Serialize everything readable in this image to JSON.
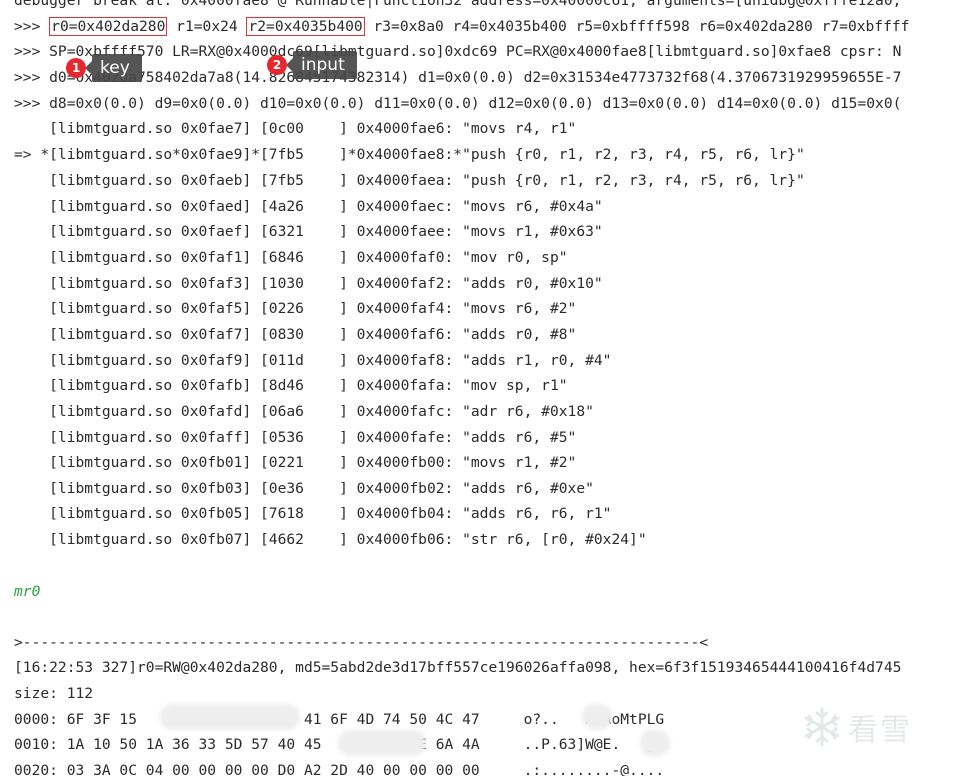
{
  "console": {
    "header_line": "debugger break at: 0x4000fae8 @ Runnable|Function32 address=0x40000c61, arguments=[unidbg@0xfffe12a0,",
    "regs_line": {
      "prompt": ">>> ",
      "r0": "r0=0x402da280",
      "mid": " r1=0x24 ",
      "r2": "r2=0x4035b400",
      "rest": " r3=0x8a0 r4=0x4035b400 r5=0xbffff598 r6=0x402da280 r7=0xbffff"
    },
    "sp_line": ">>> SP=0xbffff570 LR=RX@0x4000dc69[libmtguard.so]0xdc69 PC=RX@0x4000fae8[libmtguard.so]0xfae8 cpsr: N",
    "d0_line": ">>> d0=0x402da758402da7a8(14.826845174382314) d1=0x0(0.0) d2=0x31534e4773732f68(4.3706731929959655E-7",
    "d8_line": ">>> d8=0x0(0.0) d9=0x0(0.0) d10=0x0(0.0) d11=0x0(0.0) d12=0x0(0.0) d13=0x0(0.0) d14=0x0(0.0) d15=0x0(",
    "asm_lines": [
      "    [libmtguard.so 0x0fae7] [0c00    ] 0x4000fae6: \"movs r4, r1\"",
      "=> *[libmtguard.so*0x0fae9]*[7fb5    ]*0x4000fae8:*\"push {r0, r1, r2, r3, r4, r5, r6, lr}\"",
      "    [libmtguard.so 0x0faeb] [7fb5    ] 0x4000faea: \"push {r0, r1, r2, r3, r4, r5, r6, lr}\"",
      "    [libmtguard.so 0x0faed] [4a26    ] 0x4000faec: \"movs r6, #0x4a\"",
      "    [libmtguard.so 0x0faef] [6321    ] 0x4000faee: \"movs r1, #0x63\"",
      "    [libmtguard.so 0x0faf1] [6846    ] 0x4000faf0: \"mov r0, sp\"",
      "    [libmtguard.so 0x0faf3] [1030    ] 0x4000faf2: \"adds r0, #0x10\"",
      "    [libmtguard.so 0x0faf5] [0226    ] 0x4000faf4: \"movs r6, #2\"",
      "    [libmtguard.so 0x0faf7] [0830    ] 0x4000faf6: \"adds r0, #8\"",
      "    [libmtguard.so 0x0faf9] [011d    ] 0x4000faf8: \"adds r1, r0, #4\"",
      "    [libmtguard.so 0x0fafb] [8d46    ] 0x4000fafa: \"mov sp, r1\"",
      "    [libmtguard.so 0x0fafd] [06a6    ] 0x4000fafc: \"adr r6, #0x18\"",
      "    [libmtguard.so 0x0faff] [0536    ] 0x4000fafe: \"adds r6, #5\"",
      "    [libmtguard.so 0x0fb01] [0221    ] 0x4000fb00: \"movs r1, #2\"",
      "    [libmtguard.so 0x0fb03] [0e36    ] 0x4000fb02: \"adds r6, #0xe\"",
      "    [libmtguard.so 0x0fb05] [7618    ] 0x4000fb04: \"adds r6, r6, r1\"",
      "    [libmtguard.so 0x0fb07] [4662    ] 0x4000fb06: \"str r6, [r0, #0x24]\""
    ],
    "command": "mr0",
    "separator": ">-----------------------------------------------------------------------------<",
    "mem_header": "[16:22:53 327]r0=RW@0x402da280, md5=5abd2de3d17bff557ce196026affa098, hex=6f3f15193465444100416f4d745",
    "size_line": "size: 112",
    "hex_lines": [
      "0000: 6F 3F 15                 0 41 6F 4D 74 50 4C 47     o?..   A.AoMtPLG",
      "0010: 1A 10 50 1A 36 33 5D 57 40 45          4E 6A 4A     ..P.63]W@E.   jJ",
      "0020: 03 3A 0C 04 00 00 00 00 D0 A2 2D 40 00 00 00 00     .:........-@...."
    ]
  },
  "callouts": [
    {
      "number": "1",
      "label": "key"
    },
    {
      "number": "2",
      "label": "input"
    }
  ],
  "watermark": {
    "icon": "snowflake-icon",
    "text": "看雪"
  },
  "colors": {
    "highlight_box": "#e0323a",
    "badge": "#e8262e",
    "command_text": "#2f9e44"
  }
}
